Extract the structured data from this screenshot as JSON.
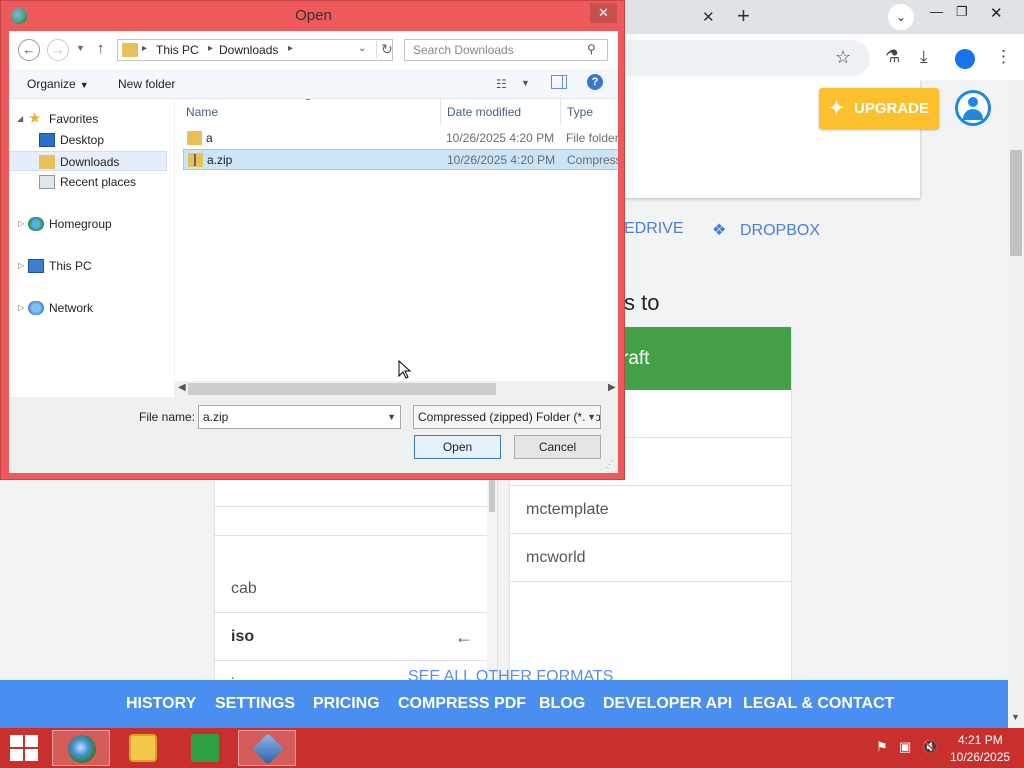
{
  "browser": {
    "tab_close": "✕",
    "new_tab": "+",
    "controls": {
      "minimize": "—",
      "restore": "❐",
      "close": "✕"
    }
  },
  "webpage": {
    "upgrade_label": "UPGRADE",
    "cloud_links": {
      "onedrive": "EDRIVE",
      "dropbox": "DROPBOX"
    },
    "section_heading": "s to",
    "green_header": "raft",
    "left_formats": [
      {
        "label": "cab",
        "bold": false
      },
      {
        "label": "iso",
        "bold": true
      },
      {
        "label": "jar",
        "bold": false
      }
    ],
    "right_formats": [
      "mctemplate",
      "mcworld"
    ],
    "see_all": "SEE ALL OTHER FORMATS",
    "nav": [
      "HISTORY",
      "SETTINGS",
      "PRICING",
      "COMPRESS PDF",
      "BLOG",
      "DEVELOPER API",
      "LEGAL & CONTACT"
    ],
    "colors": {
      "nav_bg": "#4a8ff0",
      "upgrade_bg": "#fbc02d",
      "green_header": "#43a047"
    }
  },
  "dialog": {
    "title": "Open",
    "breadcrumb": [
      "This PC",
      "Downloads"
    ],
    "search_placeholder": "Search Downloads",
    "toolbar": {
      "organize": "Organize",
      "new_folder": "New folder"
    },
    "tree": {
      "favorites": "Favorites",
      "desktop": "Desktop",
      "downloads": "Downloads",
      "recent": "Recent places",
      "homegroup": "Homegroup",
      "this_pc": "This PC",
      "network": "Network"
    },
    "columns": {
      "name": "Name",
      "date": "Date modified",
      "type": "Type"
    },
    "files": [
      {
        "name": "a",
        "date": "10/26/2025 4:20 PM",
        "type": "File folder",
        "selected": false,
        "zip": false
      },
      {
        "name": "a.zip",
        "date": "10/26/2025 4:20 PM",
        "type": "Compressed (zipped) Folder",
        "selected": true,
        "zip": true
      }
    ],
    "file_name_label": "File name:",
    "file_name_value": "a.zip",
    "file_type_value": "Compressed (zipped) Folder (*.zip)",
    "open_label": "Open",
    "cancel_label": "Cancel",
    "colors": {
      "frame": "#ee5a5c"
    }
  },
  "taskbar": {
    "time": "4:21 PM",
    "date": "10/26/2025",
    "color": "#c8302e"
  }
}
